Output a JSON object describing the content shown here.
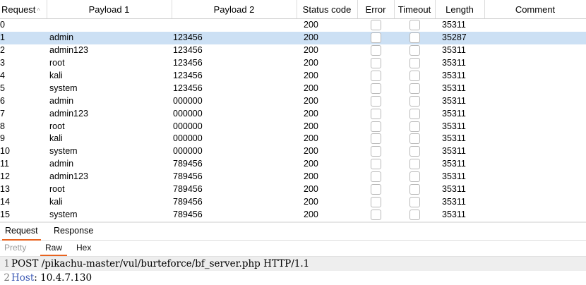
{
  "table": {
    "columns": [
      "Request",
      "Payload 1",
      "Payload 2",
      "Status code",
      "Error",
      "Timeout",
      "Length",
      "Comment"
    ],
    "sort_indicator": "^",
    "selected_request": "1",
    "rows": [
      {
        "request": "0",
        "payload1": "",
        "payload2": "",
        "status": "200",
        "error": false,
        "timeout": false,
        "length": "35311",
        "comment": ""
      },
      {
        "request": "1",
        "payload1": "admin",
        "payload2": "123456",
        "status": "200",
        "error": false,
        "timeout": false,
        "length": "35287",
        "comment": ""
      },
      {
        "request": "2",
        "payload1": "admin123",
        "payload2": "123456",
        "status": "200",
        "error": false,
        "timeout": false,
        "length": "35311",
        "comment": ""
      },
      {
        "request": "3",
        "payload1": "root",
        "payload2": "123456",
        "status": "200",
        "error": false,
        "timeout": false,
        "length": "35311",
        "comment": ""
      },
      {
        "request": "4",
        "payload1": "kali",
        "payload2": "123456",
        "status": "200",
        "error": false,
        "timeout": false,
        "length": "35311",
        "comment": ""
      },
      {
        "request": "5",
        "payload1": "system",
        "payload2": "123456",
        "status": "200",
        "error": false,
        "timeout": false,
        "length": "35311",
        "comment": ""
      },
      {
        "request": "6",
        "payload1": "admin",
        "payload2": "000000",
        "status": "200",
        "error": false,
        "timeout": false,
        "length": "35311",
        "comment": ""
      },
      {
        "request": "7",
        "payload1": "admin123",
        "payload2": "000000",
        "status": "200",
        "error": false,
        "timeout": false,
        "length": "35311",
        "comment": ""
      },
      {
        "request": "8",
        "payload1": "root",
        "payload2": "000000",
        "status": "200",
        "error": false,
        "timeout": false,
        "length": "35311",
        "comment": ""
      },
      {
        "request": "9",
        "payload1": "kali",
        "payload2": "000000",
        "status": "200",
        "error": false,
        "timeout": false,
        "length": "35311",
        "comment": ""
      },
      {
        "request": "10",
        "payload1": "system",
        "payload2": "000000",
        "status": "200",
        "error": false,
        "timeout": false,
        "length": "35311",
        "comment": ""
      },
      {
        "request": "11",
        "payload1": "admin",
        "payload2": "789456",
        "status": "200",
        "error": false,
        "timeout": false,
        "length": "35311",
        "comment": ""
      },
      {
        "request": "12",
        "payload1": "admin123",
        "payload2": "789456",
        "status": "200",
        "error": false,
        "timeout": false,
        "length": "35311",
        "comment": ""
      },
      {
        "request": "13",
        "payload1": "root",
        "payload2": "789456",
        "status": "200",
        "error": false,
        "timeout": false,
        "length": "35311",
        "comment": ""
      },
      {
        "request": "14",
        "payload1": "kali",
        "payload2": "789456",
        "status": "200",
        "error": false,
        "timeout": false,
        "length": "35311",
        "comment": ""
      },
      {
        "request": "15",
        "payload1": "system",
        "payload2": "789456",
        "status": "200",
        "error": false,
        "timeout": false,
        "length": "35311",
        "comment": ""
      }
    ]
  },
  "tabs": {
    "request": "Request",
    "response": "Response",
    "active": "request"
  },
  "subtabs": {
    "pretty": "Pretty",
    "raw": "Raw",
    "hex": "Hex",
    "active": "raw"
  },
  "editor": {
    "lines": [
      {
        "number": "1",
        "text": "POST /pikachu-master/vul/burteforce/bf_server.php HTTP/1.1"
      },
      {
        "number": "2",
        "header_name": "Host",
        "separator": ": ",
        "header_value": "10.4.7.130"
      }
    ]
  },
  "colors": {
    "selected_row": "#cce0f4",
    "active_tab_underline": "#e8631f",
    "header_name": "#3c59b4"
  }
}
